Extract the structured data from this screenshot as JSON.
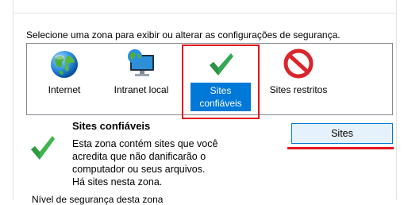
{
  "instruction": "Selecione uma zona para exibir ou alterar as configurações de segurança.",
  "zones": [
    {
      "label": "Internet",
      "icon": "globe-icon"
    },
    {
      "label": "Intranet local",
      "icon": "intranet-monitor-icon"
    },
    {
      "label_line1": "Sites",
      "label_line2": "confiáveis",
      "icon": "green-checkmark-icon",
      "selected": true
    },
    {
      "label": "Sites restritos",
      "icon": "restricted-no-icon"
    }
  ],
  "details": {
    "title": "Sites confiáveis",
    "line1": "Esta zona contém sites que você",
    "line2": "acredita que não danificarão o",
    "line3": "computador ou seus arquivos.",
    "line4": "Há sites nesta zona."
  },
  "sites_button": "Sites",
  "security_level_partial": "Nível de segurança desta zona",
  "colors": {
    "selection": "#0078d7",
    "annotation_red": "#e3161e",
    "button_bg": "#e5f1fb",
    "check_green": "#2aa84a"
  }
}
